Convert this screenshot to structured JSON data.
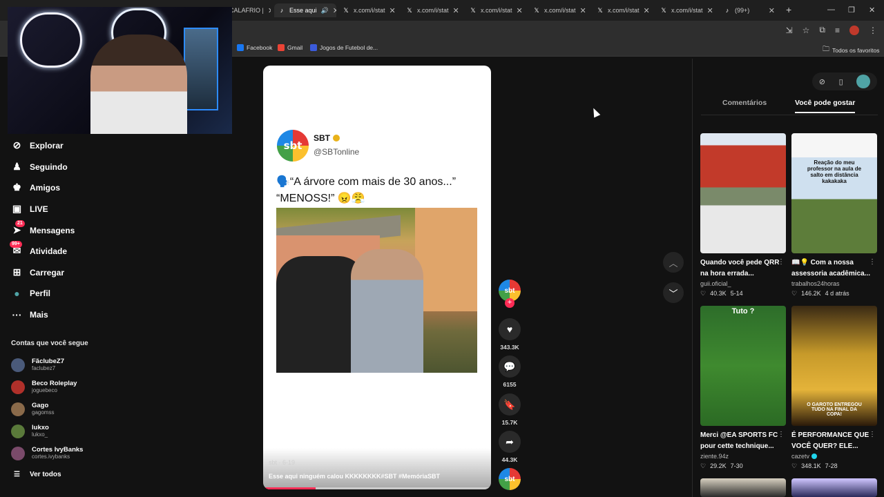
{
  "browser": {
    "tabs": [
      {
        "label": "",
        "active": false
      },
      {
        "label": "",
        "active": false
      },
      {
        "label": "",
        "active": false
      },
      {
        "label": "CALAFRIO |",
        "active": false
      },
      {
        "label": "Esse aqui",
        "active": true
      },
      {
        "label": "x.com/i/stat",
        "active": false
      },
      {
        "label": "x.com/i/stat",
        "active": false
      },
      {
        "label": "x.com/i/stat",
        "active": false
      },
      {
        "label": "x.com/i/stat",
        "active": false
      },
      {
        "label": "x.com/i/stat",
        "active": false
      },
      {
        "label": "x.com/i/stat",
        "active": false
      },
      {
        "label": "(99+)",
        "active": false
      }
    ],
    "bookmarks": [
      {
        "label": "Facebook",
        "color": "#1877f2"
      },
      {
        "label": "Gmail",
        "color": "#ea4335"
      },
      {
        "label": "Jogos de Futebol de...",
        "color": "#3b5bdb"
      }
    ],
    "all_bookmarks": "Todos os favoritos"
  },
  "nav": {
    "items": [
      {
        "label": "Explorar",
        "icon": "compass-icon",
        "glyph": "⊘"
      },
      {
        "label": "Seguindo",
        "icon": "following-icon",
        "glyph": "♟"
      },
      {
        "label": "Amigos",
        "icon": "friends-icon",
        "glyph": "♚"
      },
      {
        "label": "LIVE",
        "icon": "live-icon",
        "glyph": "▣"
      },
      {
        "label": "Mensagens",
        "icon": "messages-icon",
        "glyph": "➤",
        "badge": "21"
      },
      {
        "label": "Atividade",
        "icon": "activity-icon",
        "glyph": "✉",
        "badge": "99+"
      },
      {
        "label": "Carregar",
        "icon": "upload-icon",
        "glyph": "⊞"
      },
      {
        "label": "Perfil",
        "icon": "profile-avatar-icon",
        "glyph": "●"
      },
      {
        "label": "Mais",
        "icon": "more-icon",
        "glyph": "···"
      }
    ],
    "following_title": "Contas que você segue",
    "accounts": [
      {
        "name": "FãclubeZ7",
        "handle": "faclubez7",
        "color": "#4a5a7a"
      },
      {
        "name": "Beco Roleplay",
        "handle": "joguebeco",
        "color": "#b0302a"
      },
      {
        "name": "Gago",
        "handle": "gagomss",
        "color": "#8a6a4a"
      },
      {
        "name": "lukxo",
        "handle": "lukxo_",
        "color": "#5a7a3a"
      },
      {
        "name": "Cortes IvyBanks",
        "handle": "cortes.ivybanks",
        "color": "#7a4a6a"
      }
    ],
    "see_all": "Ver todos"
  },
  "video": {
    "tweet_name": "SBT",
    "tweet_handle": "@SBTonline",
    "tweet_line1": "🗣️“A árvore com mais de 30 anos...”",
    "tweet_line2": "“MENOSS!” 😠😤",
    "logo_text": "sbt",
    "user_line": "sbt · 6-19",
    "caption": "Esse aqui ninguém calou KKKKKKKK#SBT #MemóriaSBT",
    "progress": 0.23
  },
  "actions": {
    "likes": "343.3K",
    "comments": "6155",
    "saves": "15.7K",
    "shares": "44.3K"
  },
  "right": {
    "tabs": [
      "Comentários",
      "Você pode gostar"
    ],
    "active_tab": 1,
    "cards": [
      {
        "title": "Quando você pede QRR na hora errada...",
        "author": "guii.oficial_",
        "likes": "40.3K",
        "date": "5-14",
        "thumb_text": "",
        "verified": false
      },
      {
        "title": "📖💡 Com a nossa assessoria acadêmica...",
        "author": "trabalhos24horas",
        "likes": "146.2K",
        "date": "4 d atrás",
        "thumb_text": "Reação do meu professor na aula de salto em distância kakakaka",
        "verified": false
      },
      {
        "title": "Merci @EA SPORTS FC pour cette technique...",
        "author": "ziente.94z",
        "likes": "29.2K",
        "date": "7-30",
        "thumb_text": "Tuto ?",
        "verified": false
      },
      {
        "title": "É PERFORMANCE QUE VOCÊ QUER? ELE...",
        "author": "cazetv",
        "likes": "348.1K",
        "date": "7-28",
        "thumb_text": "O GAROTO ENTREGOU TUDO NA FINAL DA COPA!",
        "verified": true
      }
    ]
  }
}
